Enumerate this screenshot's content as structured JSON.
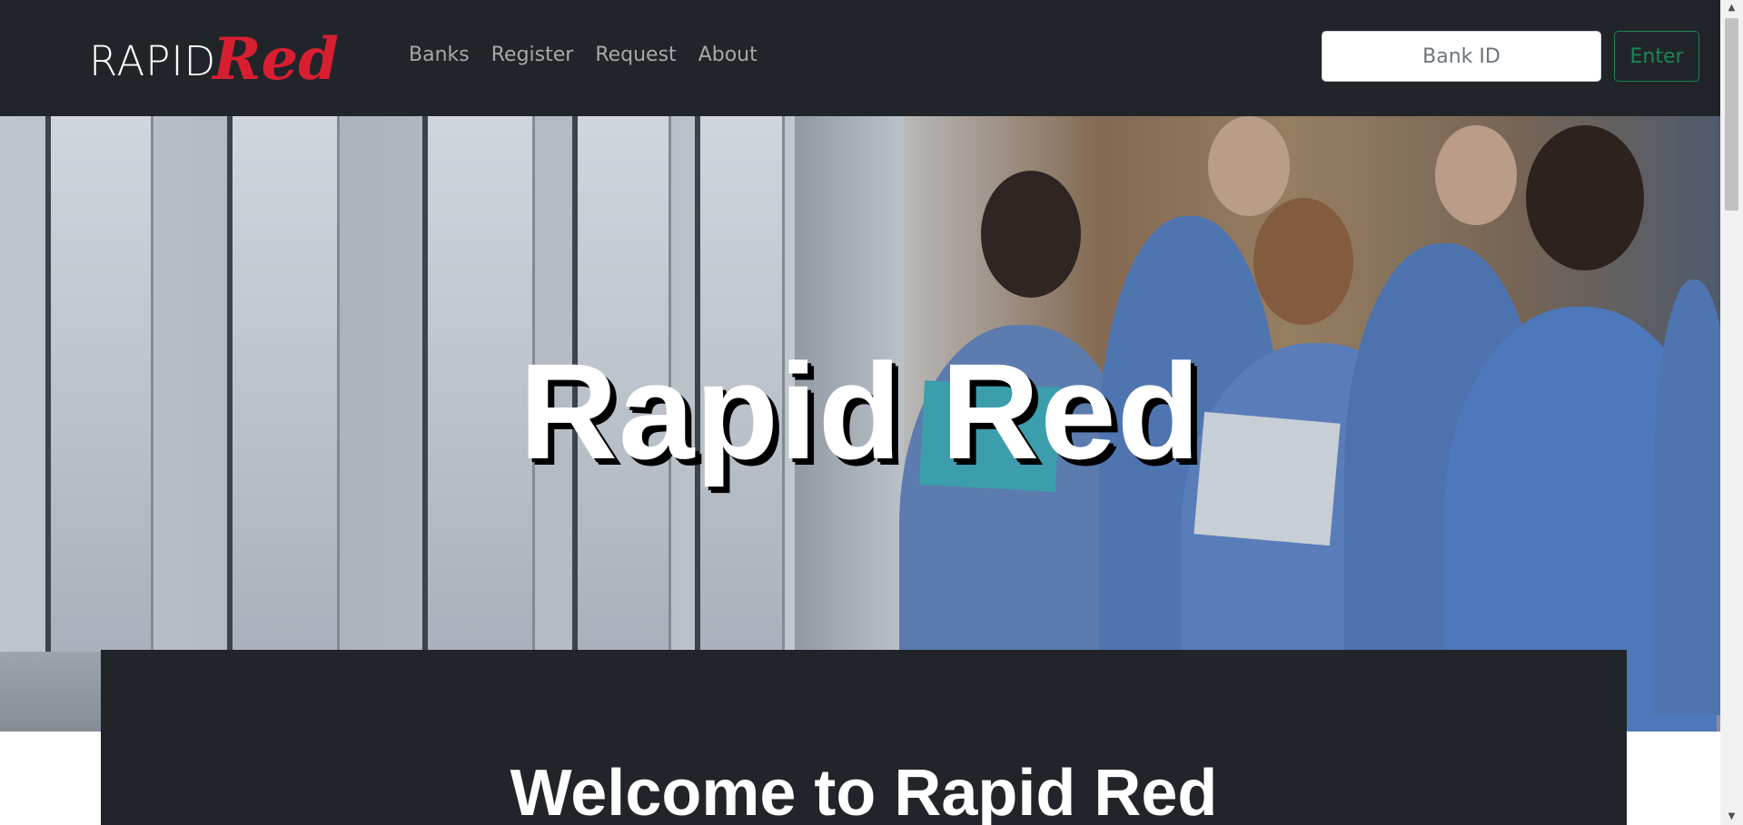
{
  "brand": {
    "logo_part1": "RAPID",
    "logo_part2": "Red"
  },
  "nav": {
    "items": [
      {
        "label": "Banks"
      },
      {
        "label": "Register"
      },
      {
        "label": "Request"
      },
      {
        "label": "About"
      }
    ]
  },
  "bank_login": {
    "placeholder": "Bank ID",
    "value": "",
    "button_label": "Enter"
  },
  "hero": {
    "title": "Rapid Red"
  },
  "welcome": {
    "title": "Welcome to Rapid Red"
  },
  "colors": {
    "navbar_bg": "#212529",
    "brand_red": "#d81f32",
    "enter_outline": "#198754"
  },
  "icons": {
    "scroll_up": "triangle-up-icon",
    "scroll_down": "triangle-down-icon"
  }
}
